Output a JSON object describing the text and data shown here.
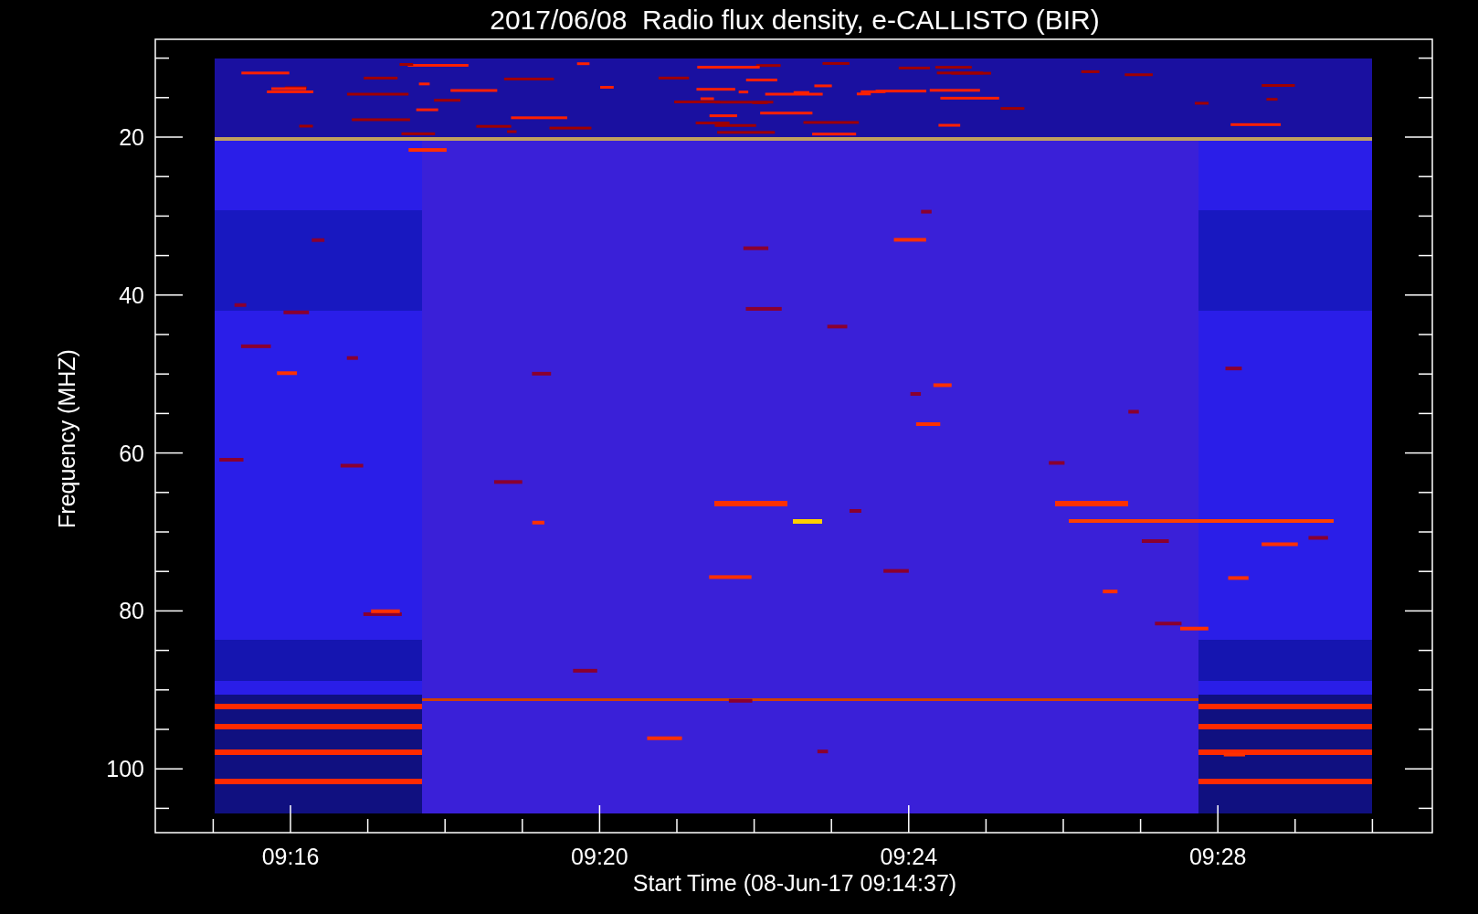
{
  "title": "2017/06/08  Radio flux density, e-CALLISTO (BIR)",
  "y_axis": {
    "label": "Frequency (MHZ)",
    "ticks": [
      "20",
      "40",
      "60",
      "80",
      "100"
    ]
  },
  "x_axis": {
    "label": "Start Time (08-Jun-17 09:14:37)",
    "ticks": [
      "09:16",
      "09:20",
      "09:24",
      "09:28"
    ]
  }
}
